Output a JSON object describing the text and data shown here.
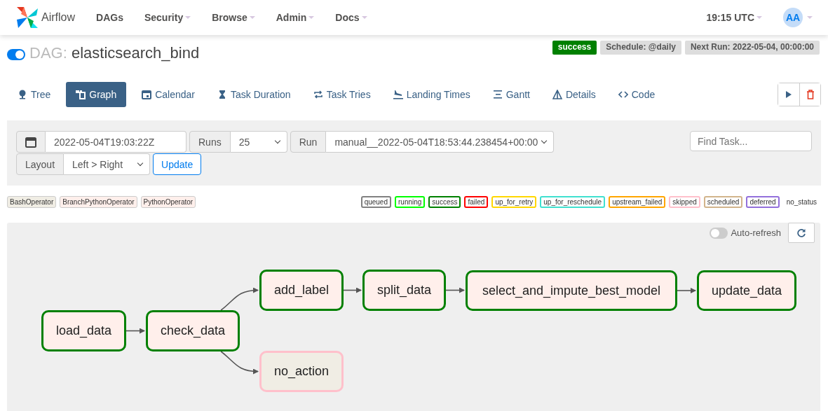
{
  "navbar": {
    "brand": "Airflow",
    "menus": [
      {
        "label": "DAGs",
        "dropdown": false
      },
      {
        "label": "Security",
        "dropdown": true
      },
      {
        "label": "Browse",
        "dropdown": true
      },
      {
        "label": "Admin",
        "dropdown": true
      },
      {
        "label": "Docs",
        "dropdown": true
      }
    ],
    "clock": "19:15 UTC",
    "avatar": "AA"
  },
  "dag": {
    "paused_toggle_on": true,
    "prefix": "DAG:",
    "name": "elasticsearch_bind",
    "badges": [
      {
        "label": "success",
        "kind": "state"
      },
      {
        "label": "Schedule: @daily",
        "kind": "info"
      },
      {
        "label": "Next Run: 2022-05-04, 00:00:00",
        "kind": "info"
      }
    ]
  },
  "tabs": [
    {
      "label": "Tree",
      "selected": false
    },
    {
      "label": "Graph",
      "selected": true
    },
    {
      "label": "Calendar",
      "selected": false
    },
    {
      "label": "Task Duration",
      "selected": false
    },
    {
      "label": "Task Tries",
      "selected": false
    },
    {
      "label": "Landing Times",
      "selected": false
    },
    {
      "label": "Gantt",
      "selected": false
    },
    {
      "label": "Details",
      "selected": false
    },
    {
      "label": "Code",
      "selected": false
    }
  ],
  "filters": {
    "date": "2022-05-04T19:03:22Z",
    "runs_label": "Runs",
    "runs": "25",
    "run_label": "Run",
    "run": "manual__2022-05-04T18:53:44.238454+00:00",
    "layout_label": "Layout",
    "layout": "Left > Right",
    "update": "Update",
    "find_placeholder": "Find Task..."
  },
  "operators": [
    {
      "label": "BashOperator",
      "color": "#f0ede4"
    },
    {
      "label": "BranchPythonOperator",
      "color": "#ffefeb"
    },
    {
      "label": "PythonOperator",
      "color": "#ffefeb"
    }
  ],
  "states": [
    {
      "label": "queued",
      "color": "#808080"
    },
    {
      "label": "running",
      "color": "#00ff00"
    },
    {
      "label": "success",
      "color": "#008000"
    },
    {
      "label": "failed",
      "color": "#ff0000"
    },
    {
      "label": "up_for_retry",
      "color": "#ffd700"
    },
    {
      "label": "up_for_reschedule",
      "color": "#40e0d0"
    },
    {
      "label": "upstream_failed",
      "color": "#ffa500"
    },
    {
      "label": "skipped",
      "color": "#ffc0cb"
    },
    {
      "label": "scheduled",
      "color": "#d2b48c"
    },
    {
      "label": "deferred",
      "color": "#9370db"
    },
    {
      "label": "no_status",
      "color": "#ffffff"
    }
  ],
  "auto_refresh": {
    "label": "Auto-refresh",
    "on": false
  },
  "graph": {
    "nodes": [
      {
        "label": "load_data",
        "color": "#008000",
        "background": {
          "color": "#ffefeb"
        }
      },
      {
        "label": "check_data",
        "color": "#008000",
        "background": {
          "color": "#ffefeb"
        }
      },
      {
        "label": "add_label",
        "color": "#008000",
        "background": {
          "color": "#ffefeb"
        }
      },
      {
        "label": "no_action",
        "color": "#ffc0cb",
        "background": {
          "color": "#f0ede4"
        }
      },
      {
        "label": "split_data",
        "color": "#008000",
        "background": {
          "color": "#ffefeb"
        }
      },
      {
        "label": "select_and_impute_best_model",
        "color": "#008000",
        "background": {
          "color": "#ffefeb"
        }
      },
      {
        "label": "update_data",
        "color": "#008000",
        "background": {
          "color": "#ffefeb"
        }
      }
    ]
  }
}
